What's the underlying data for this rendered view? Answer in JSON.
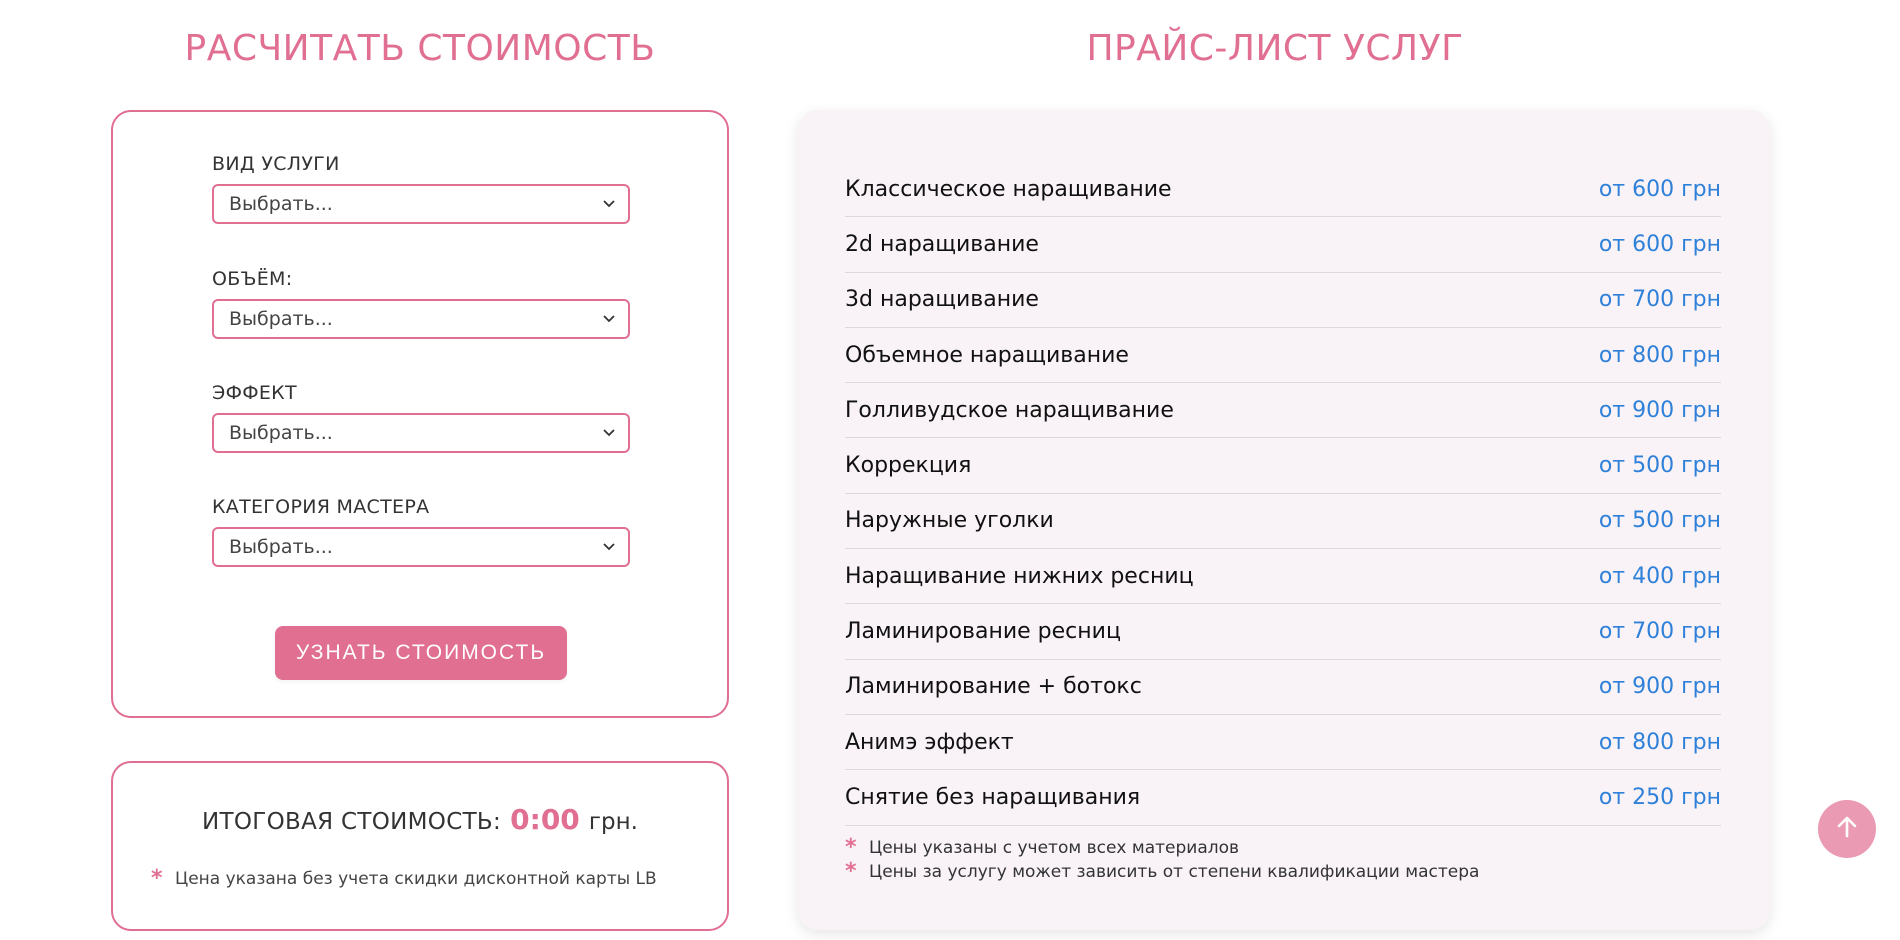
{
  "calculator": {
    "title": "РАСЧИТАТЬ СТОИМОСТЬ",
    "fields": [
      {
        "label": "ВИД УСЛУГИ",
        "value": "Выбрать..."
      },
      {
        "label": "ОБЪЁМ:",
        "value": "Выбрать..."
      },
      {
        "label": "ЭФФЕКТ",
        "value": "Выбрать..."
      },
      {
        "label": "КАТЕГОРИЯ МАСТЕРА",
        "value": "Выбрать..."
      }
    ],
    "button_label": "УЗНАТЬ СТОИМОСТЬ"
  },
  "total": {
    "label": "ИТОГОВАЯ СТОИМОСТЬ:",
    "amount": "0:00",
    "unit": "грн.",
    "note_mark": "*",
    "note": "Цена указана без учета скидки дисконтной карты LB"
  },
  "price_list": {
    "title": "ПРАЙС-ЛИСТ УСЛУГ",
    "items": [
      {
        "name": "Классическое наращивание",
        "price": "от 600 грн"
      },
      {
        "name": "2d наращивание",
        "price": "от 600 грн"
      },
      {
        "name": "3d наращивание",
        "price": "от 700 грн"
      },
      {
        "name": "Объемное наращивание",
        "price": "от 800 грн"
      },
      {
        "name": "Голливудское наращивание",
        "price": "от 900 грн"
      },
      {
        "name": "Коррекция",
        "price": "от 500 грн"
      },
      {
        "name": "Наружные уголки",
        "price": "от 500 грн"
      },
      {
        "name": "Наращивание нижних ресниц",
        "price": "от 400 грн"
      },
      {
        "name": "Ламинирование ресниц",
        "price": "от 700 грн"
      },
      {
        "name": "Ламинирование + ботокс",
        "price": "от 900 грн"
      },
      {
        "name": "Анимэ эффект",
        "price": "от 800 грн"
      },
      {
        "name": "Снятие без наращивания",
        "price": "от 250 грн"
      }
    ],
    "notes": [
      {
        "mark": "*",
        "text": "Цены указаны с учетом всех материалов"
      },
      {
        "mark": "*",
        "text": "Цены за услугу может зависить от степени квалификации мастера"
      }
    ]
  },
  "icons": {
    "select_arrow": "chevron-down-icon",
    "scroll_top": "arrow-up-icon"
  },
  "colors": {
    "accent": "#e06f92",
    "price": "#2f80d8",
    "card_bg": "#f9f3f7",
    "scroll_button": "#eb9ab3"
  }
}
